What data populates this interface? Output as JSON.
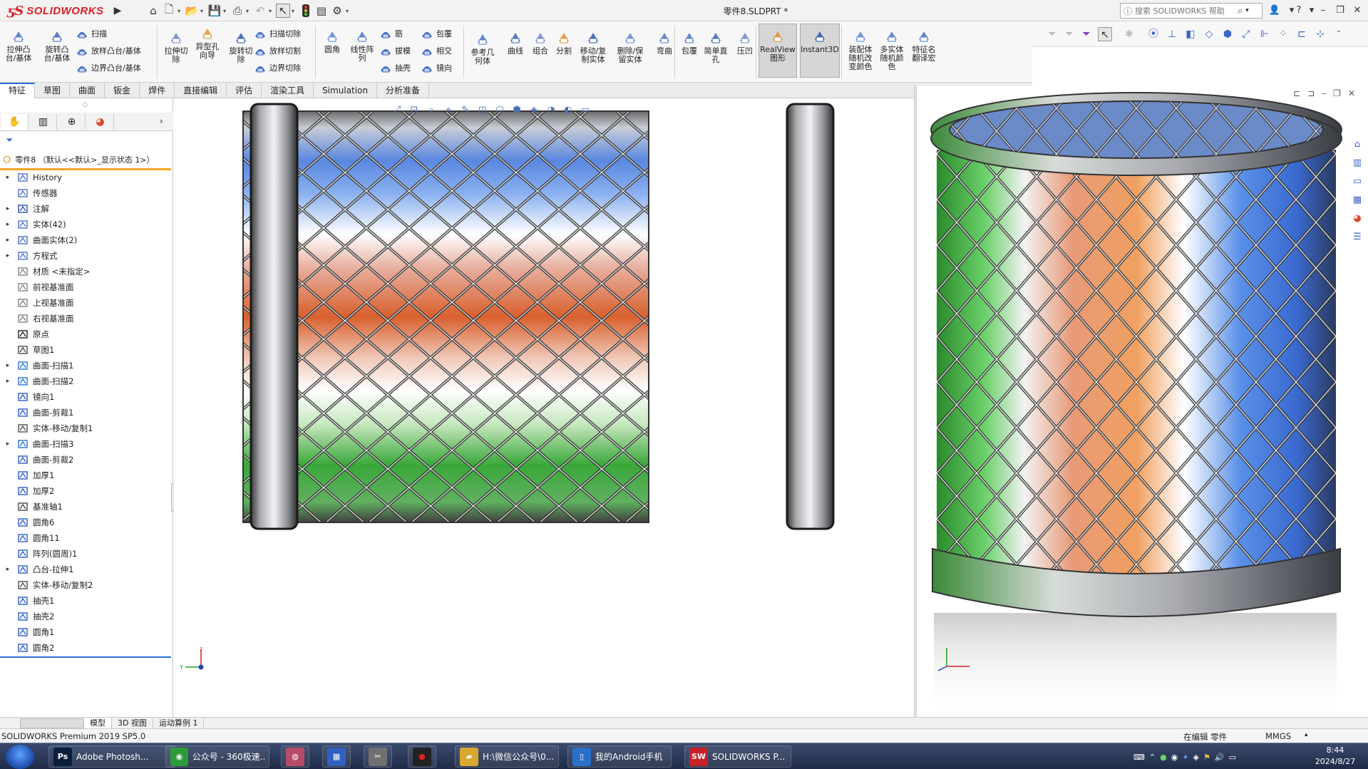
{
  "app": {
    "brand": "SOLIDWORKS",
    "document_title": "零件8.SLDPRT *",
    "help_search_placeholder": "搜索 SOLIDWORKS 帮助"
  },
  "ribbon": {
    "large_buttons": [
      {
        "id": "extrude-boss",
        "label": "拉伸凸\n台/基体"
      },
      {
        "id": "revolve-boss",
        "label": "旋转凸\n台/基体"
      },
      {
        "id": "extrude-cut",
        "label": "拉伸切\n除"
      },
      {
        "id": "hole-wizard",
        "label": "异型孔\n向导"
      },
      {
        "id": "revolve-cut",
        "label": "旋转切\n除"
      },
      {
        "id": "fillet",
        "label": "圆角"
      },
      {
        "id": "linear-pattern",
        "label": "线性阵\n列"
      },
      {
        "id": "reference-geometry",
        "label": "参考几\n何体"
      },
      {
        "id": "curves",
        "label": "曲线"
      },
      {
        "id": "combine",
        "label": "组合"
      },
      {
        "id": "split",
        "label": "分割"
      },
      {
        "id": "move-copy-body",
        "label": "移动/复\n制实体"
      },
      {
        "id": "delete-keep-body",
        "label": "删除/保\n留实体"
      },
      {
        "id": "flex",
        "label": "弯曲"
      },
      {
        "id": "wrap-large",
        "label": "包覆"
      },
      {
        "id": "simple-hole",
        "label": "简单直\n孔"
      },
      {
        "id": "indent",
        "label": "压凹"
      },
      {
        "id": "realview",
        "label": "RealView\n图形"
      },
      {
        "id": "instant3d",
        "label": "Instant3D"
      },
      {
        "id": "assembly-color",
        "label": "装配体\n随机改\n变颜色"
      },
      {
        "id": "multibody-color",
        "label": "多实体\n随机颜\n色"
      },
      {
        "id": "feature-translate",
        "label": "特征名\n翻译宏"
      }
    ],
    "small_buttons": [
      {
        "id": "sweep",
        "label": "扫描"
      },
      {
        "id": "loft-boss",
        "label": "放样凸台/基体"
      },
      {
        "id": "boundary-boss",
        "label": "边界凸台/基体"
      },
      {
        "id": "swept-cut",
        "label": "扫描切除"
      },
      {
        "id": "lofted-cut",
        "label": "放样切割"
      },
      {
        "id": "boundary-cut",
        "label": "边界切除"
      },
      {
        "id": "rib",
        "label": "筋"
      },
      {
        "id": "draft",
        "label": "拔模"
      },
      {
        "id": "shell",
        "label": "抽壳"
      },
      {
        "id": "wrap",
        "label": "包覆"
      },
      {
        "id": "intersect",
        "label": "相交"
      },
      {
        "id": "mirror",
        "label": "镜向"
      }
    ]
  },
  "tabs": [
    "特征",
    "草图",
    "曲面",
    "钣金",
    "焊件",
    "直接编辑",
    "评估",
    "渲染工具",
    "Simulation",
    "分析准备"
  ],
  "tree": {
    "root": "零件8 （默认<<默认>_显示状态 1>）",
    "items": [
      {
        "label": "History",
        "expandable": true,
        "icon": "history-icon"
      },
      {
        "label": "传感器",
        "expandable": false,
        "icon": "sensor-icon"
      },
      {
        "label": "注解",
        "expandable": true,
        "icon": "annotation-icon"
      },
      {
        "label": "实体(42)",
        "expandable": true,
        "icon": "solid-bodies-icon"
      },
      {
        "label": "曲面实体(2)",
        "expandable": true,
        "icon": "surface-bodies-icon"
      },
      {
        "label": "方程式",
        "expandable": true,
        "icon": "equation-icon"
      },
      {
        "label": "材质 <未指定>",
        "expandable": false,
        "icon": "material-icon"
      },
      {
        "label": "前视基准面",
        "expandable": false,
        "icon": "plane-icon"
      },
      {
        "label": "上视基准面",
        "expandable": false,
        "icon": "plane-icon"
      },
      {
        "label": "右视基准面",
        "expandable": false,
        "icon": "plane-icon"
      },
      {
        "label": "原点",
        "expandable": false,
        "icon": "origin-icon"
      },
      {
        "label": "草图1",
        "expandable": false,
        "icon": "sketch-icon"
      },
      {
        "label": "曲面-扫描1",
        "expandable": true,
        "icon": "surface-sweep-icon"
      },
      {
        "label": "曲面-扫描2",
        "expandable": true,
        "icon": "surface-sweep-icon"
      },
      {
        "label": "镜向1",
        "expandable": false,
        "icon": "mirror-icon"
      },
      {
        "label": "曲面-剪裁1",
        "expandable": false,
        "icon": "surface-trim-icon"
      },
      {
        "label": "实体-移动/复制1",
        "expandable": false,
        "icon": "move-copy-icon"
      },
      {
        "label": "曲面-扫描3",
        "expandable": true,
        "icon": "surface-sweep-icon"
      },
      {
        "label": "曲面-剪裁2",
        "expandable": false,
        "icon": "surface-trim-icon"
      },
      {
        "label": "加厚1",
        "expandable": false,
        "icon": "thicken-icon"
      },
      {
        "label": "加厚2",
        "expandable": false,
        "icon": "thicken-icon"
      },
      {
        "label": "基准轴1",
        "expandable": false,
        "icon": "axis-icon"
      },
      {
        "label": "圆角6",
        "expandable": false,
        "icon": "fillet-icon"
      },
      {
        "label": "圆角11",
        "expandable": false,
        "icon": "fillet-icon"
      },
      {
        "label": "阵列(圆周)1",
        "expandable": false,
        "icon": "circular-pattern-icon"
      },
      {
        "label": "凸台-拉伸1",
        "expandable": true,
        "icon": "boss-extrude-icon"
      },
      {
        "label": "实体-移动/复制2",
        "expandable": false,
        "icon": "move-copy-icon"
      },
      {
        "label": "抽壳1",
        "expandable": false,
        "icon": "shell-icon"
      },
      {
        "label": "抽壳2",
        "expandable": false,
        "icon": "shell-icon"
      },
      {
        "label": "圆角1",
        "expandable": false,
        "icon": "fillet-icon"
      },
      {
        "label": "圆角2",
        "expandable": false,
        "icon": "fillet-icon"
      }
    ]
  },
  "bottom_tabs": [
    "模型",
    "3D 视图",
    "运动算例 1"
  ],
  "status": {
    "product": "SOLIDWORKS Premium 2019 SP5.0",
    "mode": "在编辑 零件",
    "units": "MMGS"
  },
  "taskbar": {
    "items": [
      {
        "label": "Adobe Photosh...",
        "icon": "Ps",
        "color": "#0a1f3d"
      },
      {
        "label": "公众号 - 360极速...",
        "icon": "360",
        "color": "#2d9b3a"
      },
      {
        "label": "",
        "icon": "app",
        "color": "#b84b6a"
      },
      {
        "label": "",
        "icon": "win",
        "color": "#3060c0"
      },
      {
        "label": "",
        "icon": "tool",
        "color": "#707070"
      },
      {
        "label": "",
        "icon": "rec",
        "color": "#222"
      },
      {
        "label": "H:\\微信公众号\\0...",
        "icon": "folder",
        "color": "#d8a830"
      },
      {
        "label": "我的Android手机",
        "icon": "phone",
        "color": "#2a70c8"
      },
      {
        "label": "SOLIDWORKS P...",
        "icon": "SW",
        "color": "#c8202a"
      }
    ],
    "time": "8:44",
    "date": "2024/8/27"
  },
  "colors": {
    "brand_red": "#d81f26",
    "accent_blue": "#2a6fd6",
    "tree_highlight": "#f5a623"
  }
}
